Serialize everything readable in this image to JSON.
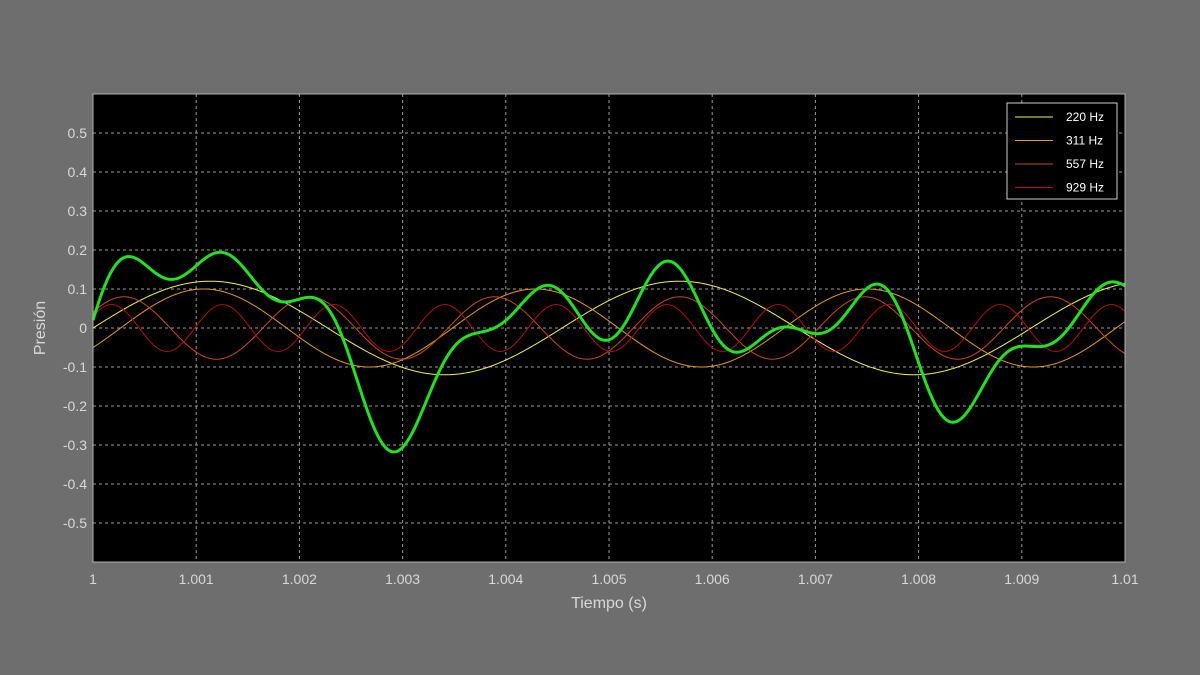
{
  "chart_data": {
    "type": "line",
    "title": "",
    "xlabel": "Tiempo (s)",
    "ylabel": "Presión",
    "xlim": [
      1.0,
      1.01
    ],
    "ylim": [
      -0.6,
      0.6
    ],
    "x_ticks": [
      1.0,
      1.001,
      1.002,
      1.003,
      1.004,
      1.005,
      1.006,
      1.007,
      1.008,
      1.009,
      1.01
    ],
    "x_tick_labels": [
      "1",
      "1.001",
      "1.002",
      "1.003",
      "1.004",
      "1.005",
      "1.006",
      "1.007",
      "1.008",
      "1.009",
      "1.01"
    ],
    "y_ticks": [
      0.5,
      0.4,
      0.3,
      0.2,
      0.1,
      0,
      -0.1,
      -0.2,
      -0.3,
      -0.4,
      -0.5
    ],
    "y_tick_labels": [
      "0.5",
      "0.4",
      "0.3",
      "0.2",
      "0.1",
      "0",
      "-0.1",
      "-0.2",
      "-0.3",
      "-0.4",
      "-0.5"
    ],
    "grid": true,
    "legend_position": "top-right",
    "background": "#000000",
    "series": [
      {
        "name": "220 Hz",
        "color": "#f2ef5a",
        "frequency_hz": 220,
        "amplitude": 0.12,
        "phase_deg": 0
      },
      {
        "name": "311 Hz",
        "color": "#e09a2a",
        "frequency_hz": 311,
        "amplitude": 0.1,
        "phase_deg": -30
      },
      {
        "name": "557 Hz",
        "color": "#c84a1e",
        "frequency_hz": 557,
        "amplitude": 0.08,
        "phase_deg": 30
      },
      {
        "name": "929 Hz",
        "color": "#b01010",
        "frequency_hz": 929,
        "amplitude": 0.06,
        "phase_deg": 30
      }
    ],
    "sum_series": {
      "color": "#22e022",
      "description_hidden": true
    }
  }
}
